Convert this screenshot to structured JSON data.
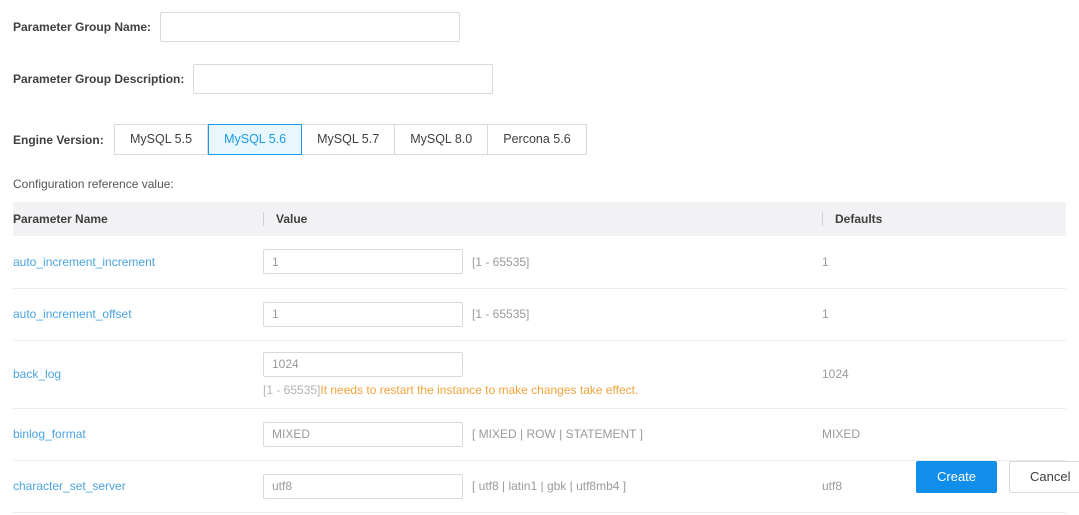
{
  "form": {
    "name_label": "Parameter Group Name:",
    "name_value": "",
    "name_placeholder": "",
    "description_label": "Parameter Group Description:",
    "description_value": "",
    "description_placeholder": "",
    "engine_label": "Engine Version:",
    "engine_options": [
      {
        "label": "MySQL 5.5",
        "selected": false
      },
      {
        "label": "MySQL 5.6",
        "selected": true
      },
      {
        "label": "MySQL 5.7",
        "selected": false
      },
      {
        "label": "MySQL 8.0",
        "selected": false
      },
      {
        "label": "Percona 5.6",
        "selected": false
      }
    ],
    "selected_engine": "MySQL 5.6"
  },
  "config_caption": "Configuration reference value:",
  "table": {
    "headers": {
      "name": "Parameter Name",
      "value": "Value",
      "defaults": "Defaults"
    },
    "rows": [
      {
        "name": "auto_increment_increment",
        "value": "1",
        "hint": "[1 - 65535]",
        "hint_position": "inline",
        "warning": "",
        "default": "1"
      },
      {
        "name": "auto_increment_offset",
        "value": "1",
        "hint": "[1 - 65535]",
        "hint_position": "inline",
        "warning": "",
        "default": "1"
      },
      {
        "name": "back_log",
        "value": "1024",
        "hint": "[1 - 65535]",
        "hint_position": "below",
        "warning": "It needs to restart the instance to make changes take effect.",
        "default": "1024"
      },
      {
        "name": "binlog_format",
        "value": "MIXED",
        "hint": "[ MIXED | ROW | STATEMENT ]",
        "hint_position": "inline",
        "warning": "",
        "default": "MIXED"
      },
      {
        "name": "character_set_server",
        "value": "utf8",
        "hint": "[ utf8 | latin1 | gbk | utf8mb4 ]",
        "hint_position": "inline",
        "warning": "",
        "default": "utf8"
      }
    ]
  },
  "actions": {
    "create_label": "Create",
    "cancel_label": "Cancel"
  },
  "colors": {
    "accent": "#108ee9",
    "tab_selected_border": "#1c9ae8",
    "tab_selected_bg": "#e8f6fd",
    "link": "#4aa3e0",
    "warning": "#f2a33c",
    "muted": "#9a9a9a",
    "header_bg": "#f2f2f5"
  }
}
